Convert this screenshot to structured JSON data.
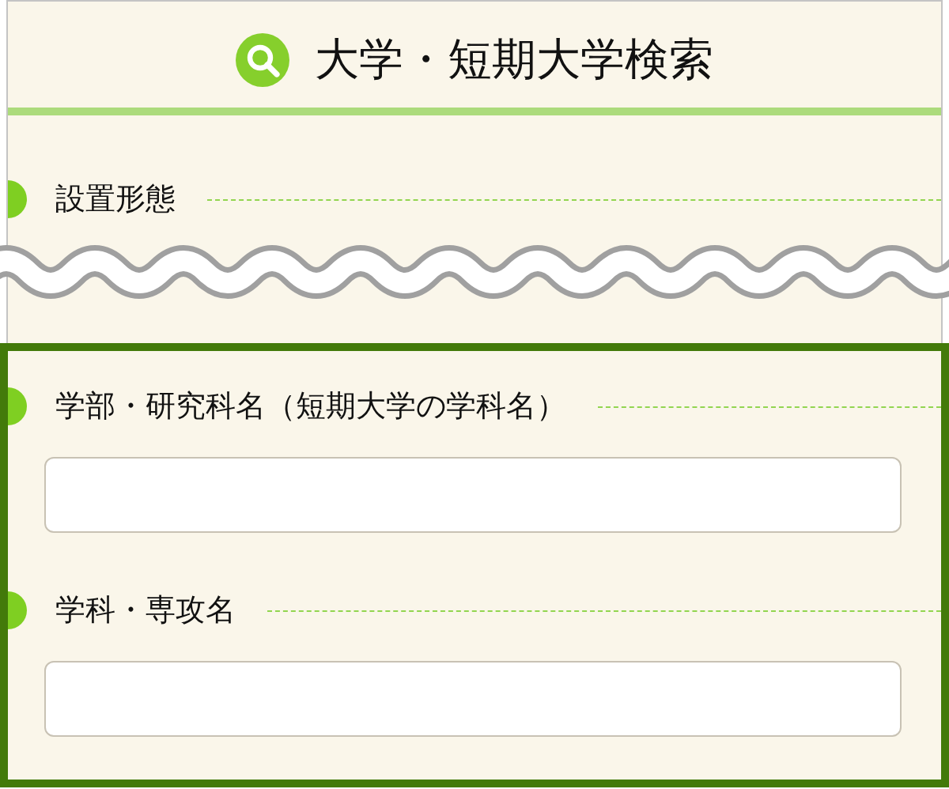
{
  "title": "大学・短期大学検索",
  "top_section": {
    "label": "設置形態"
  },
  "highlighted_fields": [
    {
      "label": "学部・研究科名（短期大学の学科名）"
    },
    {
      "label": "学科・専攻名"
    }
  ]
}
